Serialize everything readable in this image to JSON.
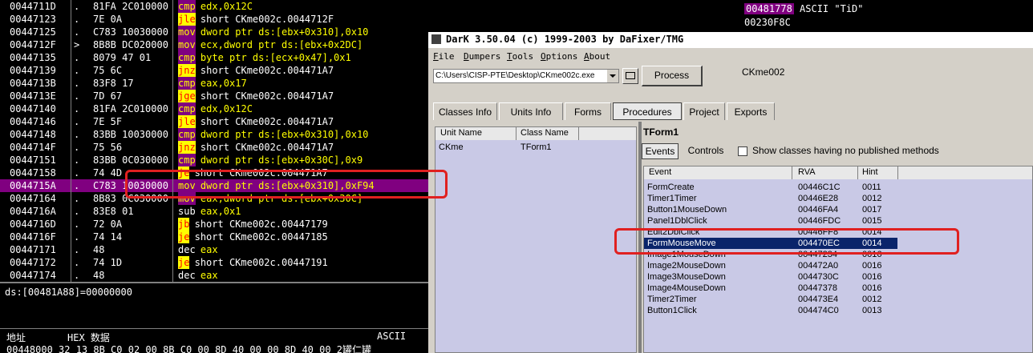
{
  "disassembly": {
    "rows": [
      {
        "addr": "0044711D",
        "mark": ".",
        "hex": "81FA 2C010000",
        "mnem": "cmp",
        "ops": "edx,0x12C",
        "kind": "cmp"
      },
      {
        "addr": "00447123",
        "mark": ".",
        "hex": "7E 0A",
        "mnem": "jle",
        "ops": "short CKme002c.0044712F",
        "kind": "jcc"
      },
      {
        "addr": "00447125",
        "mark": ".",
        "hex": "C783 10030000",
        "mnem": "mov",
        "ops": "dword ptr ds:[ebx+0x310],0x10",
        "kind": "mov"
      },
      {
        "addr": "0044712F",
        "mark": ">",
        "hex": "8B8B DC020000",
        "mnem": "mov",
        "ops": "ecx,dword ptr ds:[ebx+0x2DC]",
        "kind": "mov"
      },
      {
        "addr": "00447135",
        "mark": ".",
        "hex": "8079 47 01",
        "mnem": "cmp",
        "ops": "byte ptr ds:[ecx+0x47],0x1",
        "kind": "cmp"
      },
      {
        "addr": "00447139",
        "mark": ".",
        "hex": "75 6C",
        "mnem": "jnz",
        "ops": "short CKme002c.004471A7",
        "kind": "jcc"
      },
      {
        "addr": "0044713B",
        "mark": ".",
        "hex": "83F8 17",
        "mnem": "cmp",
        "ops": "eax,0x17",
        "kind": "cmp"
      },
      {
        "addr": "0044713E",
        "mark": ".",
        "hex": "7D 67",
        "mnem": "jge",
        "ops": "short CKme002c.004471A7",
        "kind": "jcc"
      },
      {
        "addr": "00447140",
        "mark": ".",
        "hex": "81FA 2C010000",
        "mnem": "cmp",
        "ops": "edx,0x12C",
        "kind": "cmp"
      },
      {
        "addr": "00447146",
        "mark": ".",
        "hex": "7E 5F",
        "mnem": "jle",
        "ops": "short CKme002c.004471A7",
        "kind": "jcc"
      },
      {
        "addr": "00447148",
        "mark": ".",
        "hex": "83BB 10030000",
        "mnem": "cmp",
        "ops": "dword ptr ds:[ebx+0x310],0x10",
        "kind": "cmp"
      },
      {
        "addr": "0044714F",
        "mark": ".",
        "hex": "75 56",
        "mnem": "jnz",
        "ops": "short CKme002c.004471A7",
        "kind": "jcc"
      },
      {
        "addr": "00447151",
        "mark": ".",
        "hex": "83BB 0C030000",
        "mnem": "cmp",
        "ops": "dword ptr ds:[ebx+0x30C],0x9",
        "kind": "cmp"
      },
      {
        "addr": "00447158",
        "mark": ".",
        "hex": "74 4D",
        "mnem": "je",
        "ops": "short CKme002c.004471A7",
        "kind": "jcc"
      },
      {
        "addr": "0044715A",
        "mark": ".",
        "hex": "C783 10030000",
        "mnem": "mov",
        "ops": "dword ptr ds:[ebx+0x310],0xF94",
        "kind": "mov",
        "selected": true
      },
      {
        "addr": "00447164",
        "mark": ".",
        "hex": "8B83 0C030000",
        "mnem": "mov",
        "ops": "eax,dword ptr ds:[ebx+0x30C]",
        "kind": "mov"
      },
      {
        "addr": "0044716A",
        "mark": ".",
        "hex": "83E8 01",
        "mnem": "sub",
        "ops": "eax,0x1",
        "kind": "plain"
      },
      {
        "addr": "0044716D",
        "mark": ".",
        "hex": "72 0A",
        "mnem": "jb",
        "ops": "short CKme002c.00447179",
        "kind": "jcc"
      },
      {
        "addr": "0044716F",
        "mark": ".",
        "hex": "74 14",
        "mnem": "je",
        "ops": "short CKme002c.00447185",
        "kind": "jcc"
      },
      {
        "addr": "00447171",
        "mark": ".",
        "hex": "48",
        "mnem": "dec",
        "ops": "eax",
        "kind": "plain"
      },
      {
        "addr": "00447172",
        "mark": ".",
        "hex": "74 1D",
        "mnem": "je",
        "ops": "short CKme002c.00447191",
        "kind": "jcc"
      },
      {
        "addr": "00447174",
        "mark": ".",
        "hex": "48",
        "mnem": "dec",
        "ops": "eax",
        "kind": "plain"
      }
    ]
  },
  "info": {
    "text": "ds:[00481A88]=00000000"
  },
  "dump": {
    "header_addr": "地址",
    "header_hex": "HEX 数据",
    "header_ascii": "ASCII",
    "row_text": "00448000 32 13 8B C0 02 00 8B C0 00 8D 40 00 00 8D 40 00 2罐仁罐"
  },
  "stack": {
    "addr": "00481778",
    "value": "ASCII \"TiD\"",
    "row2": "00230F8C"
  },
  "dede": {
    "title": "DarK 3.50.04 (c) 1999-2003 by DaFixer/TMG",
    "menus": [
      {
        "key": "F",
        "rest": "ile"
      },
      {
        "key": "D",
        "rest": "umpers"
      },
      {
        "key": "T",
        "rest": "ools"
      },
      {
        "key": "O",
        "rest": "ptions"
      },
      {
        "key": "A",
        "rest": "bout"
      }
    ],
    "path": "C:\\Users\\CISP-PTE\\Desktop\\CKme002c.exe",
    "process_label": "Process",
    "app_name": "CKme002",
    "tabs": [
      "Classes Info",
      "Units Info",
      "Forms",
      "Procedures",
      "Project",
      "Exports"
    ],
    "active_tab": "Procedures",
    "unit_header": {
      "unit": "Unit Name",
      "class": "Class Name"
    },
    "unit_row": {
      "unit": "CKme",
      "class": "TForm1"
    },
    "form_label": "TForm1",
    "events_tab": "Events",
    "controls_tab": "Controls",
    "show_label": "Show classes having no published methods",
    "events_header": {
      "event": "Event",
      "rva": "RVA",
      "hint": "Hint"
    },
    "events": [
      {
        "event": "FormCreate",
        "rva": "00446C1C",
        "hint": "0011"
      },
      {
        "event": "Timer1Timer",
        "rva": "00446E28",
        "hint": "0012"
      },
      {
        "event": "Button1MouseDown",
        "rva": "00446FA4",
        "hint": "0017"
      },
      {
        "event": "Panel1DblClick",
        "rva": "00446FDC",
        "hint": "0015"
      },
      {
        "event": "Edit2DblClick",
        "rva": "00446FF8",
        "hint": "0014"
      },
      {
        "event": "FormMouseMove",
        "rva": "004470EC",
        "hint": "0014",
        "selected": true
      },
      {
        "event": "Image1MouseDown",
        "rva": "00447234",
        "hint": "0016"
      },
      {
        "event": "Image2MouseDown",
        "rva": "004472A0",
        "hint": "0016"
      },
      {
        "event": "Image3MouseDown",
        "rva": "0044730C",
        "hint": "0016"
      },
      {
        "event": "Image4MouseDown",
        "rva": "00447378",
        "hint": "0016"
      },
      {
        "event": "Timer2Timer",
        "rva": "004473E4",
        "hint": "0012"
      },
      {
        "event": "Button1Click",
        "rva": "004474C0",
        "hint": "0013"
      }
    ]
  },
  "colors": {
    "selection_purple": "#800080",
    "annotation_red": "#e02020",
    "list_bg": "#c9c9e6",
    "list_selection": "#0a246a"
  }
}
